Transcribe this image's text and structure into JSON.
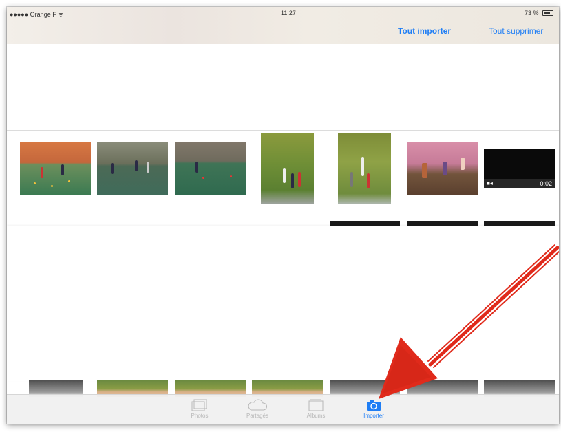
{
  "status_bar": {
    "carrier": "●●●●● Orange F ᯤ",
    "time": "11:27",
    "battery": "73 %"
  },
  "nav": {
    "import_all": "Tout importer",
    "delete_all": "Tout supprimer"
  },
  "thumbnails": [
    {
      "kind": "photo",
      "subject": "gymnasium"
    },
    {
      "kind": "photo",
      "subject": "gymnasium"
    },
    {
      "kind": "photo",
      "subject": "gymnasium"
    },
    {
      "kind": "photo",
      "subject": "gymnasium"
    },
    {
      "kind": "photo",
      "subject": "gymnasium"
    },
    {
      "kind": "photo",
      "subject": "party"
    },
    {
      "kind": "video",
      "duration": "0:02"
    }
  ],
  "tabbar": {
    "tabs": [
      {
        "label": "Photos",
        "icon": "photos-icon",
        "active": false
      },
      {
        "label": "Partagés",
        "icon": "cloud-icon",
        "active": false
      },
      {
        "label": "Albums",
        "icon": "albums-icon",
        "active": false
      },
      {
        "label": "Importer",
        "icon": "camera-icon",
        "active": true
      }
    ]
  },
  "colors": {
    "accent": "#1f7ef5",
    "annotation_arrow": "#e02a1b"
  }
}
